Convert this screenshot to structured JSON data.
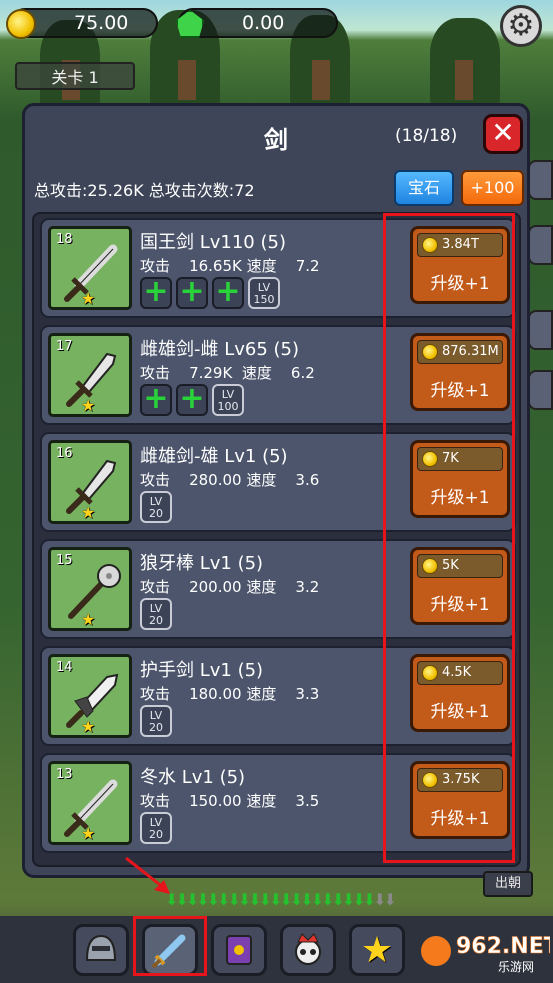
{
  "currency": {
    "gold": "75.00",
    "gems": "0.00"
  },
  "level_tab": "关卡 1",
  "panel": {
    "title": "剑",
    "count": "(18/18)",
    "summary": "总攻击:25.26K 总攻击次数:72",
    "gem_button": "宝石",
    "plus_button": "+100"
  },
  "items": [
    {
      "num": "18",
      "name": "国王剑 Lv110 (5)",
      "stats": "攻击    16.65K 速度    7.2",
      "plus_count": 3,
      "lv_badge": [
        "LV",
        "150"
      ],
      "cost": "3.84T",
      "upgrade": "升级+1",
      "icon": "sword-icon"
    },
    {
      "num": "17",
      "name": "雌雄剑-雌 Lv65 (5)",
      "stats": "攻击    7.29K  速度    6.2",
      "plus_count": 2,
      "lv_badge": [
        "LV",
        "100"
      ],
      "cost": "876.31M",
      "upgrade": "升级+1",
      "icon": "leaf-sword-icon"
    },
    {
      "num": "16",
      "name": "雌雄剑-雄 Lv1 (5)",
      "stats": "攻击    280.00 速度    3.6",
      "plus_count": 0,
      "lv_badge": [
        "LV",
        "20"
      ],
      "cost": "7K",
      "upgrade": "升级+1",
      "icon": "leaf-sword-icon"
    },
    {
      "num": "15",
      "name": "狼牙棒 Lv1 (5)",
      "stats": "攻击    200.00 速度    3.2",
      "plus_count": 0,
      "lv_badge": [
        "LV",
        "20"
      ],
      "cost": "5K",
      "upgrade": "升级+1",
      "icon": "mace-icon"
    },
    {
      "num": "14",
      "name": "护手剑 Lv1 (5)",
      "stats": "攻击    180.00 速度    3.3",
      "plus_count": 0,
      "lv_badge": [
        "LV",
        "20"
      ],
      "cost": "4.5K",
      "upgrade": "升级+1",
      "icon": "broad-sword-icon"
    },
    {
      "num": "13",
      "name": "冬水 Lv1 (5)",
      "stats": "攻击    150.00 速度    3.5",
      "plus_count": 0,
      "lv_badge": [
        "LV",
        "20"
      ],
      "cost": "3.75K",
      "upgrade": "升级+1",
      "icon": "sword-icon"
    }
  ],
  "sortie_label": "出朝",
  "dock": [
    {
      "icon": "helmet-icon"
    },
    {
      "icon": "sword-icon"
    },
    {
      "icon": "spellbook-icon"
    },
    {
      "icon": "skull-crown-icon"
    },
    {
      "icon": "star-icon"
    }
  ],
  "watermark": {
    "brand": "962.NET",
    "sub": "乐游网"
  },
  "colors": {
    "panel_bg": "#3e4558",
    "row_bg": "#4c556b",
    "upgrade_btn": "#c25a1a",
    "highlight": "#e8141c",
    "gem_btn": "#1e84e0",
    "plus_btn": "#f46a0c"
  }
}
